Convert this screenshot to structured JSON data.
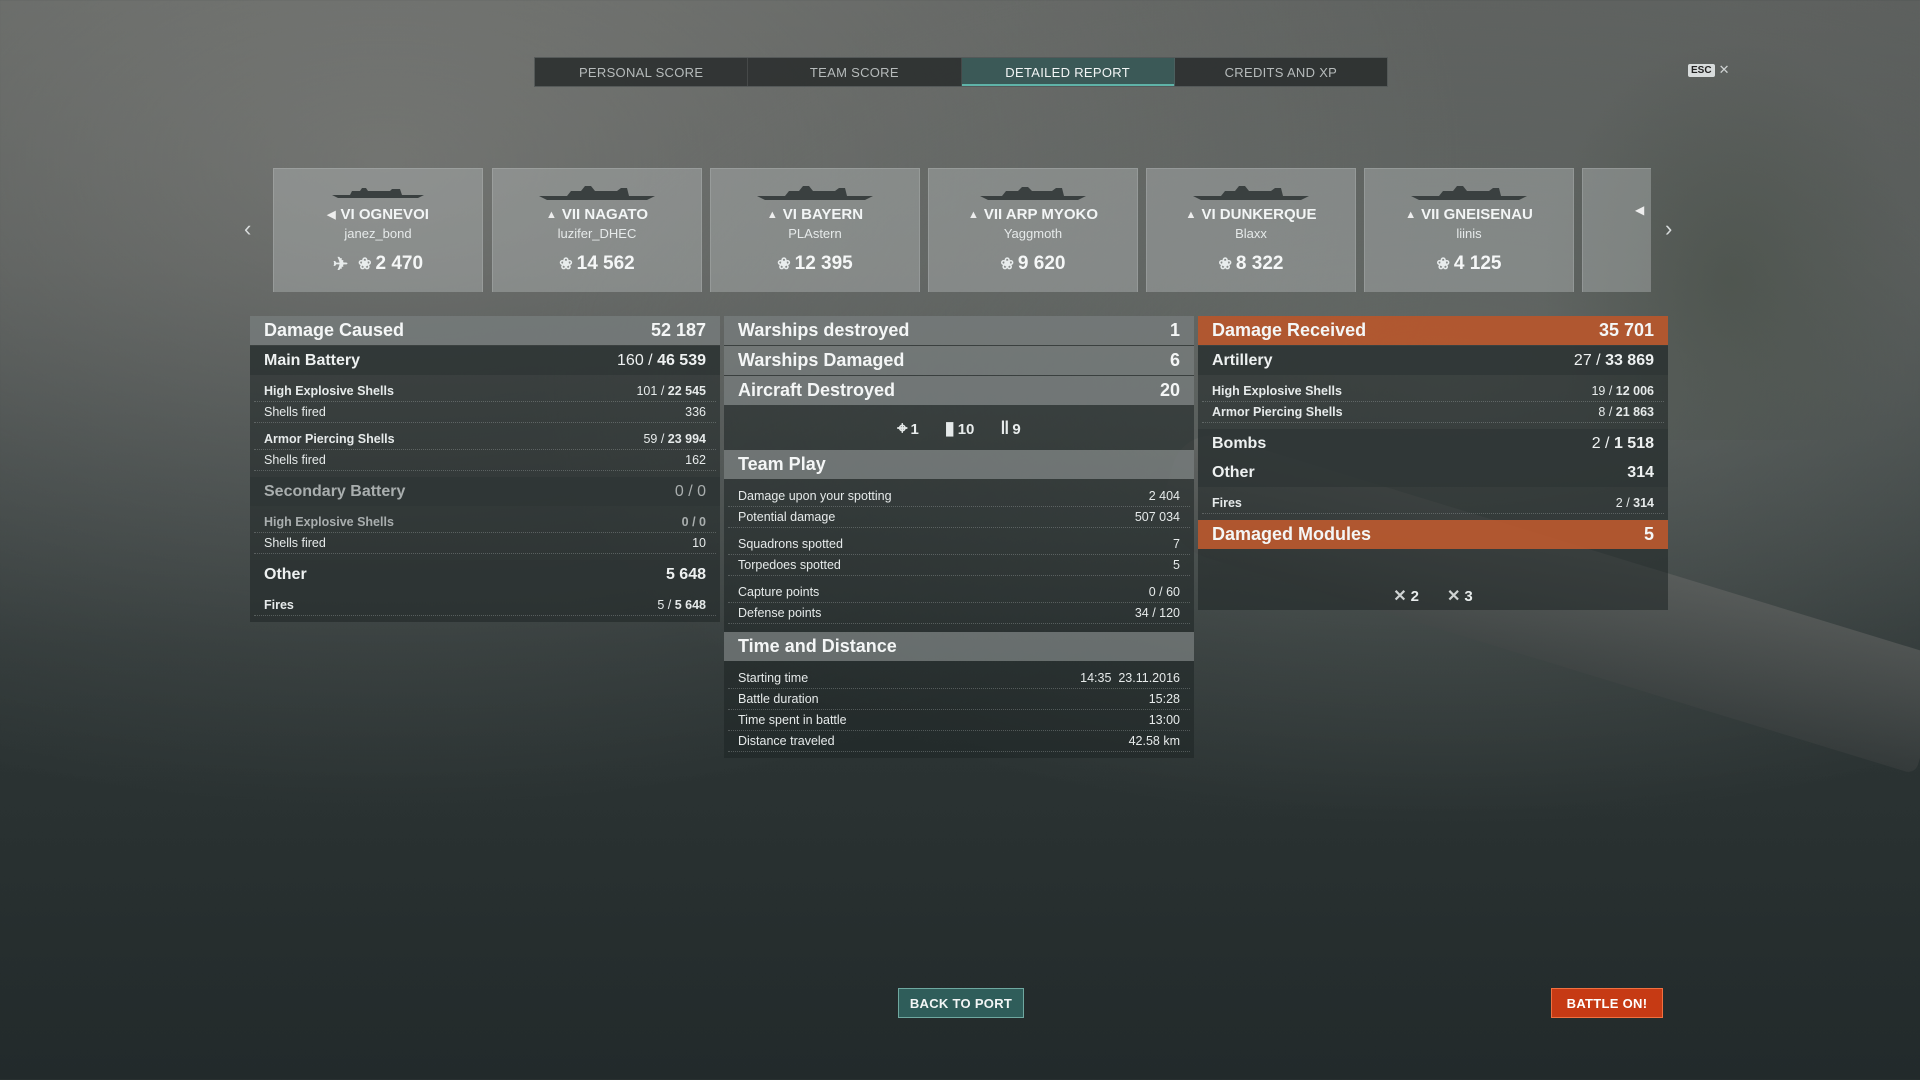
{
  "tabs": [
    {
      "label": "PERSONAL SCORE"
    },
    {
      "label": "TEAM SCORE"
    },
    {
      "label": "DETAILED REPORT",
      "active": true
    },
    {
      "label": "CREDITS AND XP"
    }
  ],
  "esc": {
    "key": "ESC",
    "close": "✕"
  },
  "ships": [
    {
      "type_icon": "destroyer-icon",
      "name": "VI OGNEVOI",
      "player": "janez_bond",
      "xp": "2 470"
    },
    {
      "type_icon": "battleship-icon",
      "name": "VII NAGATO",
      "player": "luzifer_DHEC",
      "xp": "14 562"
    },
    {
      "type_icon": "battleship-icon",
      "name": "VI BAYERN",
      "player": "PLAstern",
      "xp": "12 395"
    },
    {
      "type_icon": "cruiser-icon",
      "name": "VII ARP MYOKO",
      "player": "Yaggmoth",
      "xp": "9 620"
    },
    {
      "type_icon": "battleship-icon",
      "name": "VI DUNKERQUE",
      "player": "Blaxx",
      "xp": "8 322"
    },
    {
      "type_icon": "battleship-icon",
      "name": "VII GNEISENAU",
      "player": "liinis",
      "xp": "4 125"
    }
  ],
  "left": {
    "damage_caused": {
      "label": "Damage Caused",
      "value": "52 187"
    },
    "main_battery": {
      "label": "Main Battery",
      "hits": "160",
      "damage": "46 539"
    },
    "he_shells": {
      "label": "High Explosive Shells",
      "hits": "101",
      "damage": "22 545"
    },
    "he_fired": {
      "label": "Shells fired",
      "value": "336"
    },
    "ap_shells": {
      "label": "Armor Piercing Shells",
      "hits": "59",
      "damage": "23 994"
    },
    "ap_fired": {
      "label": "Shells fired",
      "value": "162"
    },
    "secondary": {
      "label": "Secondary Battery",
      "value": "0 / 0"
    },
    "sec_he": {
      "label": "High Explosive Shells",
      "value": "0 / 0"
    },
    "sec_fired": {
      "label": "Shells fired",
      "value": "10"
    },
    "other": {
      "label": "Other",
      "value": "5 648"
    },
    "fires": {
      "label": "Fires",
      "hits": "5",
      "damage": "5 648"
    }
  },
  "middle": {
    "warships_destroyed": {
      "label": "Warships destroyed",
      "value": "1"
    },
    "warships_damaged": {
      "label": "Warships Damaged",
      "value": "6"
    },
    "aircraft_destroyed": {
      "label": "Aircraft Destroyed",
      "value": "20"
    },
    "aircraft_breakdown": {
      "fighters": "1",
      "bombers": "10",
      "torpedo": "9"
    },
    "team_play": {
      "label": "Team Play"
    },
    "spotting_damage": {
      "label": "Damage upon your spotting",
      "value": "2 404"
    },
    "potential_damage": {
      "label": "Potential damage",
      "value": "507 034"
    },
    "squadrons_spotted": {
      "label": "Squadrons spotted",
      "value": "7"
    },
    "torpedoes_spotted": {
      "label": "Torpedoes spotted",
      "value": "5"
    },
    "capture_points": {
      "label": "Capture points",
      "value": "0 / 60"
    },
    "defense_points": {
      "label": "Defense points",
      "value": "34 / 120"
    },
    "time_distance": {
      "label": "Time and Distance"
    },
    "starting_time": {
      "label": "Starting time",
      "value": "14:35  23.11.2016"
    },
    "battle_duration": {
      "label": "Battle duration",
      "value": "15:28"
    },
    "time_in_battle": {
      "label": "Time spent in battle",
      "value": "13:00"
    },
    "distance": {
      "label": "Distance traveled",
      "value": "42.58 km"
    }
  },
  "right": {
    "damage_received": {
      "label": "Damage Received",
      "value": "35 701"
    },
    "artillery": {
      "label": "Artillery",
      "hits": "27",
      "damage": "33 869"
    },
    "he_shells": {
      "label": "High Explosive Shells",
      "hits": "19",
      "damage": "12 006"
    },
    "ap_shells": {
      "label": "Armor Piercing Shells",
      "hits": "8",
      "damage": "21 863"
    },
    "bombs": {
      "label": "Bombs",
      "hits": "2",
      "damage": "1 518"
    },
    "other": {
      "label": "Other",
      "value": "314"
    },
    "fires": {
      "label": "Fires",
      "hits": "2",
      "damage": "314"
    },
    "damaged_modules": {
      "label": "Damaged Modules",
      "value": "5"
    },
    "modules": {
      "steering": "2",
      "turret": "3"
    }
  },
  "buttons": {
    "back": "BACK TO PORT",
    "battle": "BATTLE ON!"
  }
}
